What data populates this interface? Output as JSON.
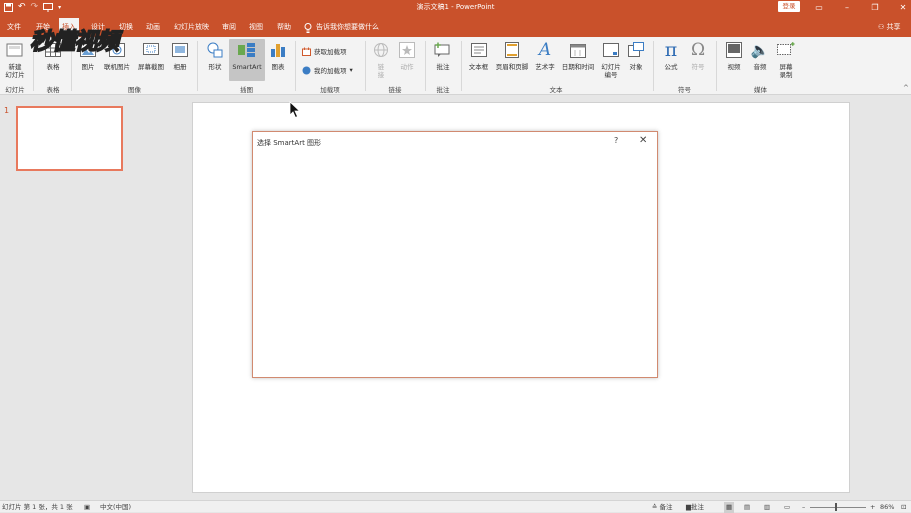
{
  "titlebar": {
    "doc_title": "演示文稿1 - PowerPoint",
    "login": "登录",
    "qat": [
      "save-icon",
      "undo-icon",
      "redo-icon",
      "start-slideshow-icon",
      "customize-icon"
    ],
    "window_controls": [
      "ribbon-display-icon",
      "minimize-icon",
      "restore-icon",
      "close-icon"
    ]
  },
  "tabs": {
    "items": [
      "文件",
      "开始",
      "插入",
      "设计",
      "切换",
      "动画",
      "幻灯片放映",
      "审阅",
      "视图",
      "帮助"
    ],
    "active": "插入",
    "tell_me": "告诉我你想要做什么",
    "share": "共享"
  },
  "logo_text": "秒懂视频",
  "ribbon": {
    "new_slide": "新建\n幻灯片",
    "table": "表格",
    "picture": "图片",
    "online_picture": "联机图片",
    "screenshot": "屏幕截图",
    "album": "相册",
    "shapes": "形状",
    "smartart": "SmartArt",
    "chart": "图表",
    "get_addins": "获取加载项",
    "my_addins": "我的加载项",
    "link": "链\n接",
    "action": "动作",
    "comment": "批注",
    "textbox": "文本框",
    "header_footer": "页眉和页脚",
    "wordart": "艺术字",
    "datetime": "日期和时间",
    "slide_number": "幻灯片\n编号",
    "object": "对象",
    "equation": "公式",
    "symbol": "符号",
    "video": "视频",
    "audio": "音频",
    "screen_recording": "屏幕\n录制",
    "groups": {
      "slides": "幻灯片",
      "tables": "表格",
      "images": "图像",
      "illustrations": "插图",
      "addins": "加载项",
      "links": "链接",
      "comments": "批注",
      "text": "文本",
      "symbols": "符号",
      "media": "媒体"
    }
  },
  "slides_panel": {
    "slide_number": "1"
  },
  "dialog": {
    "title": "选择 SmartArt 图形",
    "help": "?",
    "close": "✕"
  },
  "statusbar": {
    "slide_info": "幻灯片 第 1 张，共 1 张",
    "language": "中文(中国)",
    "notes": "备注",
    "comments": "批注",
    "zoom": "86%"
  },
  "colors": {
    "accent": "#c9512b",
    "ribbon_bg": "#f3f3f3",
    "workspace_bg": "#e6e6e6",
    "thumb_border": "#e8795d"
  }
}
